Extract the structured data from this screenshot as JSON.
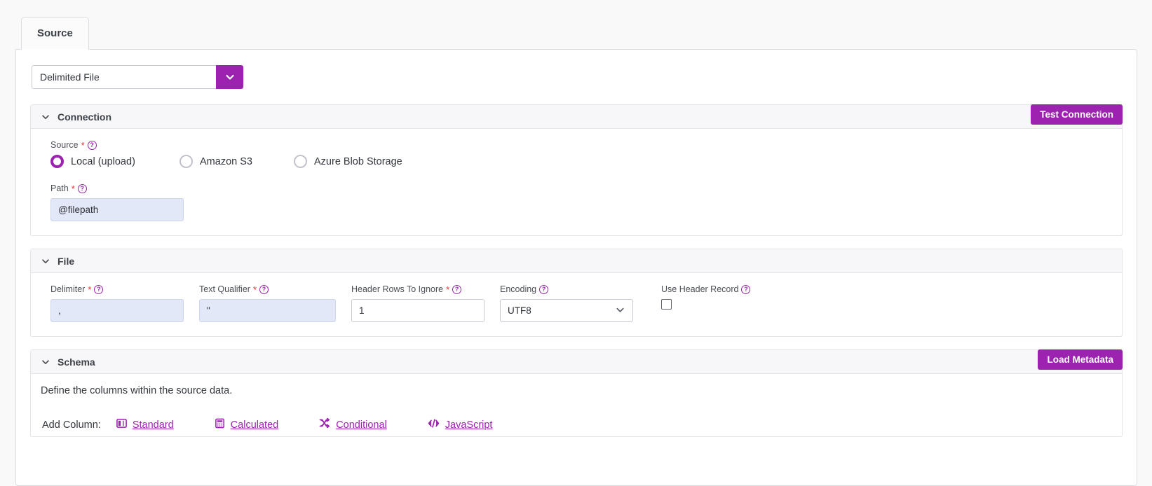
{
  "theme": {
    "accent": "#9c22b0",
    "required_color": "#e03030",
    "token_bg": "#e2e8f7",
    "page_bg": "#f9f9fa"
  },
  "tabs": [
    {
      "label": "Source",
      "active": true
    }
  ],
  "source_type": {
    "value": "Delimited File",
    "icon": "chevron-down-icon"
  },
  "connection": {
    "title": "Connection",
    "test_button": "Test Connection",
    "source_field": {
      "label": "Source",
      "required": "*",
      "help": "?",
      "options": [
        {
          "label": "Local (upload)",
          "selected": true
        },
        {
          "label": "Amazon S3",
          "selected": false
        },
        {
          "label": "Azure Blob Storage",
          "selected": false
        }
      ]
    },
    "path_field": {
      "label": "Path",
      "required": "*",
      "help": "?",
      "value": "@filepath",
      "placeholder": ""
    }
  },
  "file": {
    "title": "File",
    "fields": [
      {
        "key": "delimiter",
        "label": "Delimiter",
        "required": "*",
        "help": "?",
        "value": ",",
        "token": true
      },
      {
        "key": "text_qualifier",
        "label": "Text Qualifier",
        "required": "*",
        "help": "?",
        "value": "\"",
        "token": true
      },
      {
        "key": "header_rows_to_ignore",
        "label": "Header Rows To Ignore",
        "required": "*",
        "help": "?",
        "value": "1",
        "token": false
      },
      {
        "key": "encoding",
        "label": "Encoding",
        "required": "",
        "help": "?",
        "value": "UTF8",
        "token": false
      },
      {
        "key": "use_header_record",
        "label": "Use Header Record",
        "required": "",
        "help": "?",
        "value": "",
        "checked": false
      }
    ]
  },
  "schema": {
    "title": "Schema",
    "load_button": "Load Metadata",
    "description": "Define the columns within the source data.",
    "add_column_label": "Add Column:",
    "add_column_links": [
      {
        "label": "Standard",
        "icon": "columns-icon"
      },
      {
        "label": "Calculated",
        "icon": "calculator-icon"
      },
      {
        "label": "Conditional",
        "icon": "shuffle-icon"
      },
      {
        "label": "JavaScript",
        "icon": "code-icon"
      }
    ]
  }
}
